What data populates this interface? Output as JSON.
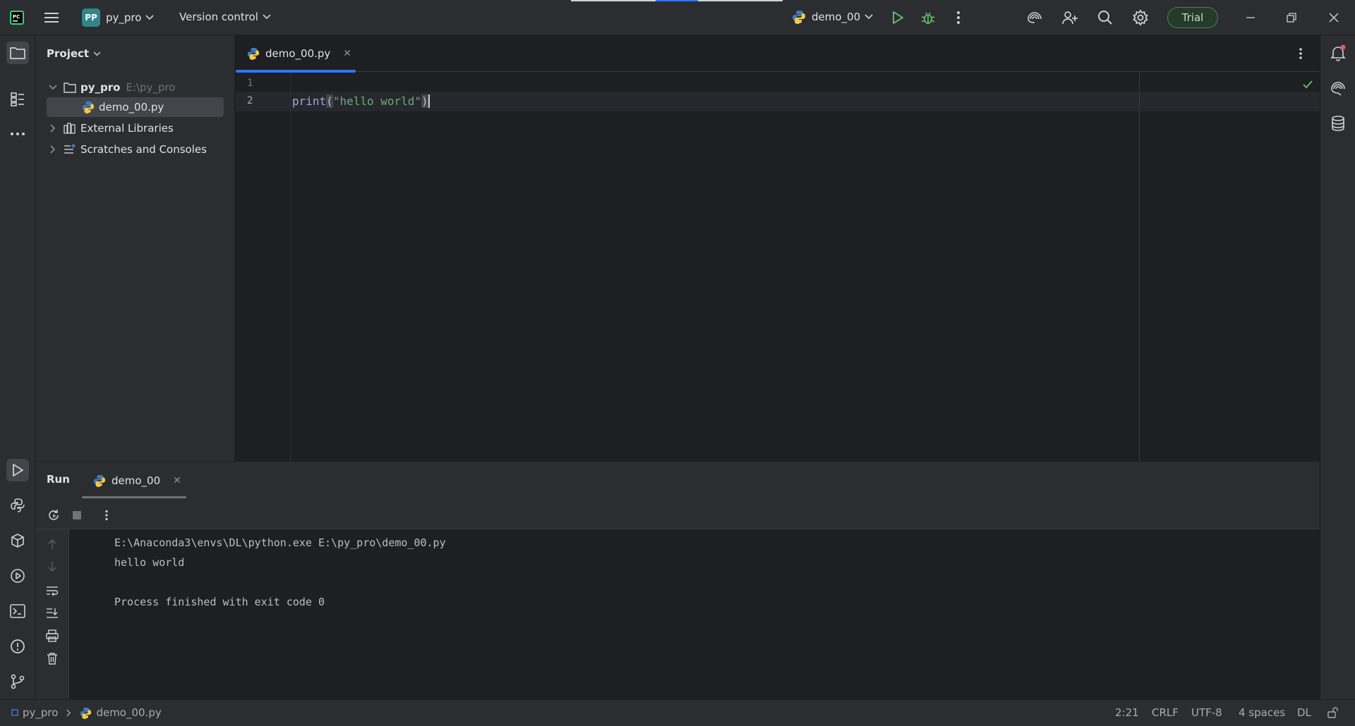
{
  "titlebar": {
    "project_badge": "PP",
    "project_name": "py_pro",
    "vcs_label": "Version control",
    "run_config": "demo_00",
    "trial_label": "Trial"
  },
  "project_panel": {
    "header": "Project",
    "root_name": "py_pro",
    "root_path": "E:\\py_pro",
    "items": [
      {
        "label": "demo_00.py"
      },
      {
        "label": "External Libraries"
      },
      {
        "label": "Scratches and Consoles"
      }
    ]
  },
  "editor": {
    "tab_label": "demo_00.py",
    "close_glyph": "✕",
    "line_numbers": [
      "1",
      "2"
    ],
    "code": {
      "fn": "print",
      "open_paren": "(",
      "string": "\"hello world\"",
      "close_paren": ")"
    }
  },
  "run_panel": {
    "title": "Run",
    "tab_label": "demo_00",
    "console_lines": [
      "E:\\Anaconda3\\envs\\DL\\python.exe E:\\py_pro\\demo_00.py",
      "hello world",
      "",
      "Process finished with exit code 0"
    ]
  },
  "statusbar": {
    "project": "py_pro",
    "file": "demo_00.py",
    "position": "2:21",
    "line_ending": "CRLF",
    "encoding": "UTF-8",
    "indent": "4 spaces",
    "interpreter": "DL"
  },
  "colors": {
    "background": "#1e1f22",
    "panel": "#2b2d30",
    "accent": "#3574f0",
    "run_green": "#5fb865",
    "keyword_purple": "#b09fdb",
    "string_green": "#6aab73"
  }
}
